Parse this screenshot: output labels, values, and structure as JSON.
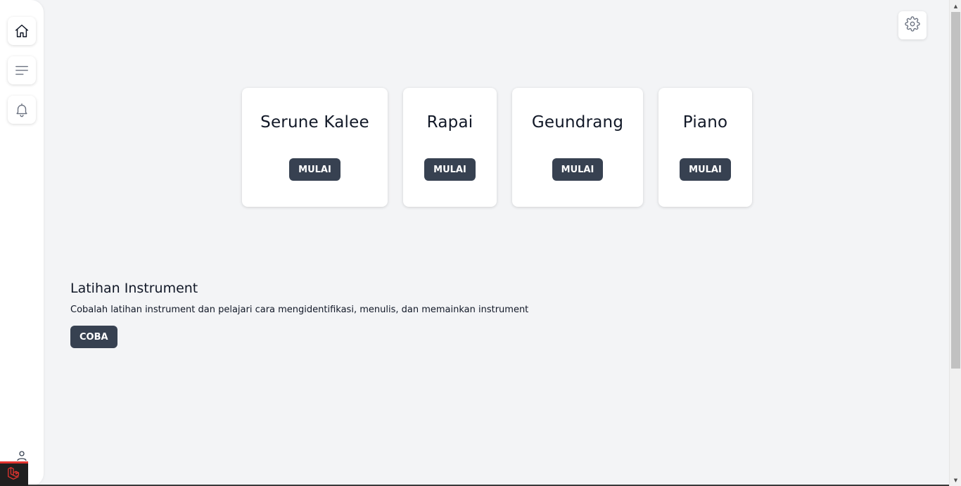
{
  "sidebar": {
    "items": [
      {
        "icon": "home-icon"
      },
      {
        "icon": "menu-icon"
      },
      {
        "icon": "bell-icon"
      }
    ],
    "user_icon": "user-icon",
    "badge_icon": "laravel-logo-icon"
  },
  "header": {
    "settings_icon": "gear-icon"
  },
  "instruments": [
    {
      "title": "Serune Kalee",
      "button": "MULAI"
    },
    {
      "title": "Rapai",
      "button": "MULAI"
    },
    {
      "title": "Geundrang",
      "button": "MULAI"
    },
    {
      "title": "Piano",
      "button": "MULAI"
    }
  ],
  "practice": {
    "title": "Latihan Instrument",
    "description": "Cobalah latihan instrument dan pelajari cara mengidentifikasi, menulis, dan memainkan instrument",
    "button": "COBA"
  },
  "colors": {
    "background": "#f3f4f6",
    "card": "#ffffff",
    "button": "#374151",
    "button_text": "#ffffff",
    "badge_accent": "#e3342f"
  }
}
